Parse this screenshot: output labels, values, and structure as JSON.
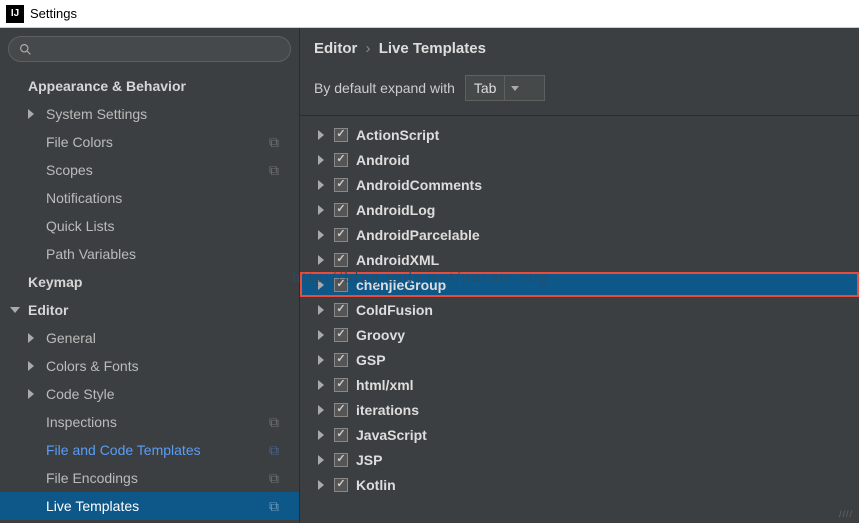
{
  "title": "Settings",
  "breadcrumb": {
    "editor": "Editor",
    "live_templates": "Live Templates"
  },
  "expand": {
    "label": "By default expand with",
    "value": "Tab"
  },
  "sidebar": {
    "appearance": "Appearance & Behavior",
    "system_settings": "System Settings",
    "file_colors": "File Colors",
    "scopes": "Scopes",
    "notifications": "Notifications",
    "quick_lists": "Quick Lists",
    "path_variables": "Path Variables",
    "keymap": "Keymap",
    "editor": "Editor",
    "general": "General",
    "colors_fonts": "Colors & Fonts",
    "code_style": "Code Style",
    "inspections": "Inspections",
    "file_code_templates": "File and Code Templates",
    "file_encodings": "File Encodings",
    "live_templates": "Live Templates"
  },
  "templates": [
    "ActionScript",
    "Android",
    "AndroidComments",
    "AndroidLog",
    "AndroidParcelable",
    "AndroidXML",
    "chenjieGroup",
    "ColdFusion",
    "Groovy",
    "GSP",
    "html/xml",
    "iterations",
    "JavaScript",
    "JSP",
    "Kotlin"
  ],
  "watermark": "http://blog.csdn.net/pucao_cug"
}
